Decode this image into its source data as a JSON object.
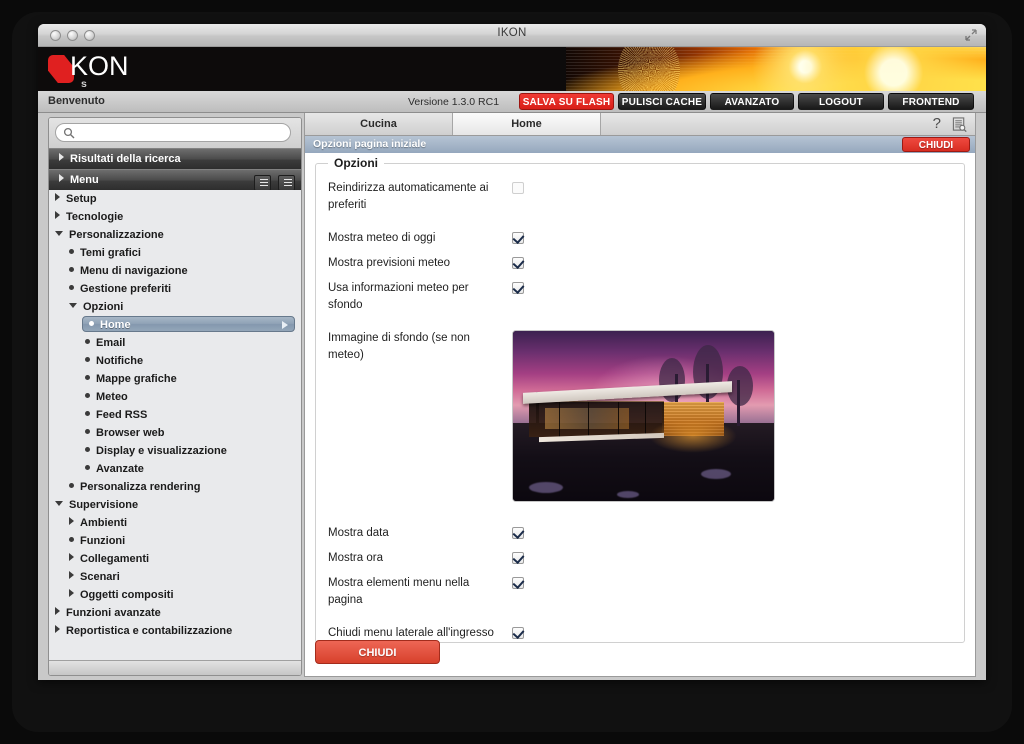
{
  "window": {
    "title": "IKON",
    "maximize_icon": "maximize-icon",
    "traffic_lights": [
      "close",
      "minimize",
      "zoom"
    ]
  },
  "brand": {
    "logo_main": "KON",
    "logo_sub": "s e r v e r",
    "accent_color": "#e02020"
  },
  "toolbar": {
    "welcome": "Benvenuto",
    "version": "Versione 1.3.0 RC1",
    "buttons": [
      {
        "label": "SALVA SU FLASH",
        "style": "red"
      },
      {
        "label": "PULISCI CACHE",
        "style": "dark"
      },
      {
        "label": "AVANZATO",
        "style": "dark"
      },
      {
        "label": "LOGOUT",
        "style": "dark"
      },
      {
        "label": "FRONTEND",
        "style": "dark"
      }
    ]
  },
  "sidebar": {
    "search_placeholder": "",
    "search_value": "",
    "search_icon": "search-icon",
    "sections": [
      {
        "label": "Risultati della ricerca",
        "expanded": false
      },
      {
        "label": "Menu",
        "expanded": false,
        "tools": [
          "expand-all-icon",
          "collapse-all-icon"
        ]
      }
    ],
    "tree": [
      {
        "label": "Setup",
        "level": 0,
        "marker": "right",
        "selected": false
      },
      {
        "label": "Tecnologie",
        "level": 0,
        "marker": "right",
        "selected": false
      },
      {
        "label": "Personalizzazione",
        "level": 0,
        "marker": "down",
        "selected": false
      },
      {
        "label": "Temi grafici",
        "level": 1,
        "marker": "dot",
        "selected": false
      },
      {
        "label": "Menu di navigazione",
        "level": 1,
        "marker": "dot",
        "selected": false
      },
      {
        "label": "Gestione preferiti",
        "level": 1,
        "marker": "dot",
        "selected": false
      },
      {
        "label": "Opzioni",
        "level": 1,
        "marker": "down",
        "selected": false
      },
      {
        "label": "Home",
        "level": 2,
        "marker": "dot",
        "selected": true
      },
      {
        "label": "Email",
        "level": 2,
        "marker": "dot",
        "selected": false
      },
      {
        "label": "Notifiche",
        "level": 2,
        "marker": "dot",
        "selected": false
      },
      {
        "label": "Mappe grafiche",
        "level": 2,
        "marker": "dot",
        "selected": false
      },
      {
        "label": "Meteo",
        "level": 2,
        "marker": "dot",
        "selected": false
      },
      {
        "label": "Feed RSS",
        "level": 2,
        "marker": "dot",
        "selected": false
      },
      {
        "label": "Browser web",
        "level": 2,
        "marker": "dot",
        "selected": false
      },
      {
        "label": "Display e visualizzazione",
        "level": 2,
        "marker": "dot",
        "selected": false
      },
      {
        "label": "Avanzate",
        "level": 2,
        "marker": "dot",
        "selected": false
      },
      {
        "label": "Personalizza rendering",
        "level": 1,
        "marker": "dot",
        "selected": false
      },
      {
        "label": "Supervisione",
        "level": 0,
        "marker": "down",
        "selected": false
      },
      {
        "label": "Ambienti",
        "level": 1,
        "marker": "right",
        "selected": false
      },
      {
        "label": "Funzioni",
        "level": 1,
        "marker": "dot",
        "selected": false
      },
      {
        "label": "Collegamenti",
        "level": 1,
        "marker": "right",
        "selected": false
      },
      {
        "label": "Scenari",
        "level": 1,
        "marker": "right",
        "selected": false
      },
      {
        "label": "Oggetti compositi",
        "level": 1,
        "marker": "right",
        "selected": false
      },
      {
        "label": "Funzioni avanzate",
        "level": 0,
        "marker": "right",
        "selected": false
      },
      {
        "label": "Reportistica e contabilizzazione",
        "level": 0,
        "marker": "right",
        "selected": false
      }
    ]
  },
  "main": {
    "tabs": [
      {
        "label": "Cucina",
        "active": false
      },
      {
        "label": "Home",
        "active": true
      }
    ],
    "help_icon": "?",
    "doc_search_icon": "document-search-icon",
    "subbar_title": "Opzioni pagina iniziale",
    "close_top_label": "CHIUDI",
    "close_bottom_label": "CHIUDI",
    "fieldset_legend": "Opzioni",
    "accent_red": "#d8412c",
    "rows": [
      {
        "label": "Reindirizza automaticamente ai preferiti",
        "type": "checkbox",
        "checked": false,
        "disabled": true
      },
      {
        "label": "Mostra meteo di oggi",
        "type": "checkbox",
        "checked": true
      },
      {
        "label": "Mostra previsioni meteo",
        "type": "checkbox",
        "checked": true
      },
      {
        "label": "Usa informazioni meteo per sfondo",
        "type": "checkbox",
        "checked": true
      },
      {
        "label": "Immagine di sfondo (se non meteo)",
        "type": "image",
        "image_alt": "modern-house-at-dusk"
      },
      {
        "label": "Mostra data",
        "type": "checkbox",
        "checked": true
      },
      {
        "label": "Mostra ora",
        "type": "checkbox",
        "checked": true
      },
      {
        "label": "Mostra elementi menu nella pagina",
        "type": "checkbox",
        "checked": true
      },
      {
        "label": "Chiudi menu laterale all'ingresso",
        "type": "checkbox",
        "checked": true
      }
    ]
  }
}
